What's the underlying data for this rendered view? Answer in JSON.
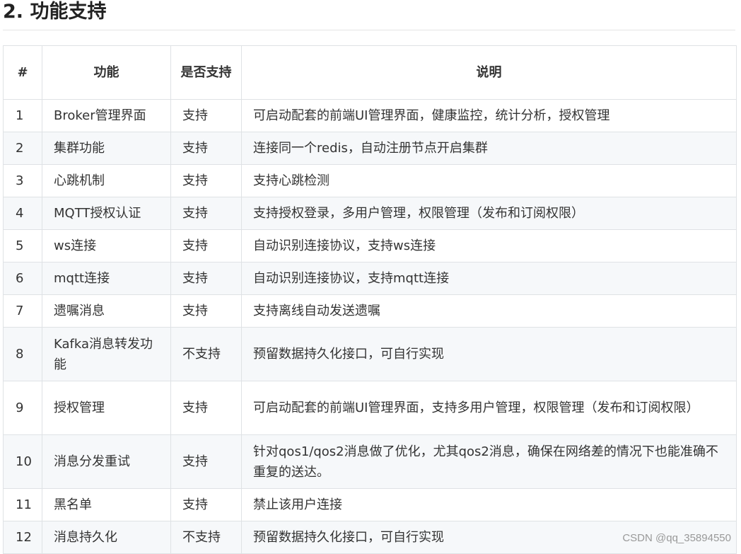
{
  "heading": "2. 功能支持",
  "table": {
    "headers": [
      "#",
      "功能",
      "是否支持",
      "说明"
    ],
    "rows": [
      [
        "1",
        "Broker管理界面",
        "支持",
        "可启动配套的前端UI管理界面，健康监控，统计分析，授权管理"
      ],
      [
        "2",
        "集群功能",
        "支持",
        "连接同一个redis，自动注册节点开启集群"
      ],
      [
        "3",
        "心跳机制",
        "支持",
        "支持心跳检测"
      ],
      [
        "4",
        "MQTT授权认证",
        "支持",
        "支持授权登录，多用户管理，权限管理（发布和订阅权限）"
      ],
      [
        "5",
        "ws连接",
        "支持",
        "自动识别连接协议，支持ws连接"
      ],
      [
        "6",
        "mqtt连接",
        "支持",
        "自动识别连接协议，支持mqtt连接"
      ],
      [
        "7",
        "遗嘱消息",
        "支持",
        "支持离线自动发送遗嘱"
      ],
      [
        "8",
        "Kafka消息转发功能",
        "不支持",
        "预留数据持久化接口，可自行实现"
      ],
      [
        "9",
        "授权管理",
        "支持",
        "可启动配套的前端UI管理界面，支持多用户管理，权限管理（发布和订阅权限）"
      ],
      [
        "10",
        "消息分发重试",
        "支持",
        "针对qos1/qos2消息做了优化，尤其qos2消息，确保在网络差的情况下也能准确不重复的送达。"
      ],
      [
        "11",
        "黑名单",
        "支持",
        "禁止该用户连接"
      ],
      [
        "12",
        "消息持久化",
        "不支持",
        "预留数据持久化接口，可自行实现"
      ]
    ]
  },
  "watermark": "CSDN @qq_35894550"
}
